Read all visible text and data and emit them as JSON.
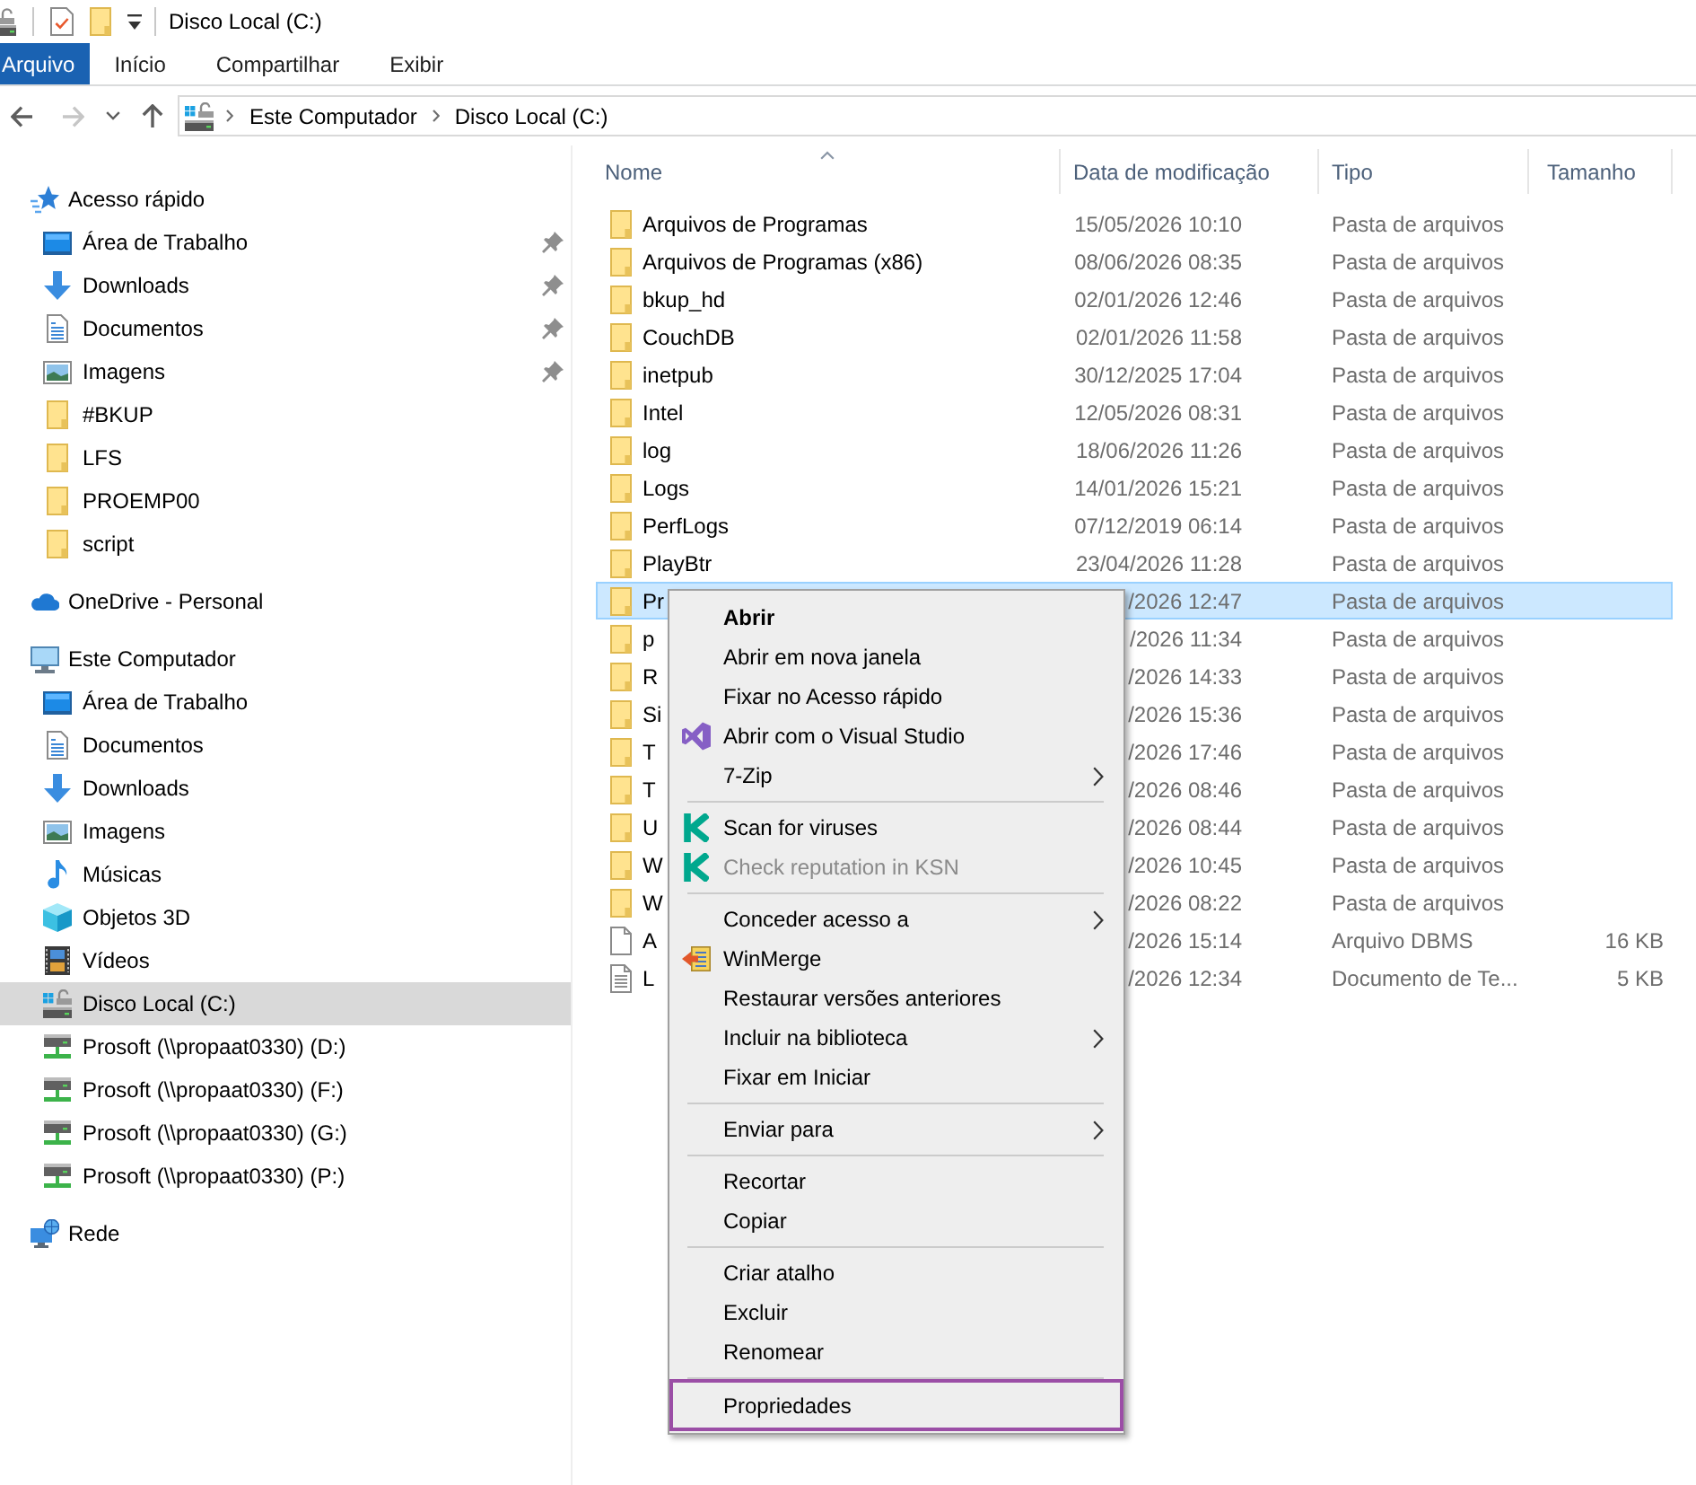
{
  "title_bar": {
    "title": "Disco Local (C:)"
  },
  "ribbon_tabs": [
    {
      "label": "Arquivo",
      "kind": "backstage"
    },
    {
      "label": "Início",
      "kind": "tab"
    },
    {
      "label": "Compartilhar",
      "kind": "tab"
    },
    {
      "label": "Exibir",
      "kind": "tab"
    }
  ],
  "navigation": [
    {
      "kind": "back",
      "disabled": false
    },
    {
      "kind": "forward",
      "disabled": true
    },
    {
      "kind": "recent",
      "disabled": false
    },
    {
      "kind": "up",
      "disabled": false
    }
  ],
  "address_bar": {
    "path": [
      "Este Computador",
      "Disco Local (C:)"
    ]
  },
  "sidebar": {
    "items": [
      {
        "label": "Acesso rápido",
        "kind": "star",
        "selected": false,
        "children": [
          {
            "label": "Área de Trabalho",
            "kind": "desktop",
            "pinned": true,
            "selected": false
          },
          {
            "label": "Downloads",
            "kind": "downloads",
            "pinned": true,
            "selected": false
          },
          {
            "label": "Documentos",
            "kind": "documents",
            "pinned": true,
            "selected": false
          },
          {
            "label": "Imagens",
            "kind": "pictures",
            "pinned": true,
            "selected": false
          },
          {
            "label": "#BKUP",
            "kind": "folder",
            "pinned": false,
            "selected": false
          },
          {
            "label": "LFS",
            "kind": "folder",
            "pinned": false,
            "selected": false
          },
          {
            "label": "PROEMP00",
            "kind": "folder",
            "pinned": false,
            "selected": false
          },
          {
            "label": "script",
            "kind": "folder",
            "pinned": false,
            "selected": false
          }
        ]
      },
      {
        "label": "OneDrive - Personal",
        "kind": "cloud",
        "selected": false
      },
      {
        "label": "Este Computador",
        "kind": "computer",
        "selected": false,
        "children": [
          {
            "label": "Área de Trabalho",
            "kind": "desktop",
            "selected": false
          },
          {
            "label": "Documentos",
            "kind": "documents",
            "selected": false
          },
          {
            "label": "Downloads",
            "kind": "downloads",
            "selected": false
          },
          {
            "label": "Imagens",
            "kind": "pictures",
            "selected": false
          },
          {
            "label": "Músicas",
            "kind": "music",
            "selected": false
          },
          {
            "label": "Objetos 3D",
            "kind": "cube",
            "selected": false
          },
          {
            "label": "Vídeos",
            "kind": "videos",
            "selected": false
          },
          {
            "label": "Disco Local (C:)",
            "kind": "drive",
            "selected": true
          },
          {
            "label": "Prosoft (\\\\propaat0330) (D:)",
            "kind": "netdrive",
            "selected": false
          },
          {
            "label": "Prosoft (\\\\propaat0330) (F:)",
            "kind": "netdrive",
            "selected": false
          },
          {
            "label": "Prosoft (\\\\propaat0330) (G:)",
            "kind": "netdrive",
            "selected": false
          },
          {
            "label": "Prosoft (\\\\propaat0330) (P:)",
            "kind": "netdrive",
            "selected": false
          }
        ]
      },
      {
        "label": "Rede",
        "kind": "network",
        "selected": false
      }
    ]
  },
  "file_list": {
    "columns": [
      {
        "label": "Nome",
        "sorted": true
      },
      {
        "label": "Data de modificação",
        "sorted": false
      },
      {
        "label": "Tipo",
        "sorted": false
      },
      {
        "label": "Tamanho",
        "sorted": false
      }
    ],
    "rows": [
      {
        "name": "Arquivos de Programas",
        "modified": "15/05/2026 10:10",
        "type": "Pasta de arquivos",
        "kind": "folder",
        "selected": false
      },
      {
        "name": "Arquivos de Programas (x86)",
        "modified": "08/06/2026 08:35",
        "type": "Pasta de arquivos",
        "kind": "folder",
        "selected": false
      },
      {
        "name": "bkup_hd",
        "modified": "02/01/2026 12:46",
        "type": "Pasta de arquivos",
        "kind": "folder",
        "selected": false
      },
      {
        "name": "CouchDB",
        "modified": "02/01/2026 11:58",
        "type": "Pasta de arquivos",
        "kind": "folder",
        "selected": false
      },
      {
        "name": "inetpub",
        "modified": "30/12/2025 17:04",
        "type": "Pasta de arquivos",
        "kind": "folder",
        "selected": false
      },
      {
        "name": "Intel",
        "modified": "12/05/2026 08:31",
        "type": "Pasta de arquivos",
        "kind": "folder",
        "selected": false
      },
      {
        "name": "log",
        "modified": "18/06/2026 11:26",
        "type": "Pasta de arquivos",
        "kind": "folder",
        "selected": false
      },
      {
        "name": "Logs",
        "modified": "14/01/2026 15:21",
        "type": "Pasta de arquivos",
        "kind": "folder",
        "selected": false
      },
      {
        "name": "PerfLogs",
        "modified": "07/12/2019 06:14",
        "type": "Pasta de arquivos",
        "kind": "folder",
        "selected": false
      },
      {
        "name": "PlayBtr",
        "modified": "23/04/2026 11:28",
        "type": "Pasta de arquivos",
        "kind": "folder",
        "selected": false
      },
      {
        "name": "Pr",
        "modified": "/2026 12:47",
        "type": "Pasta de arquivos",
        "kind": "folder",
        "selected": true
      },
      {
        "name": "p",
        "modified": "/2026 11:34",
        "type": "Pasta de arquivos",
        "kind": "folder",
        "selected": false
      },
      {
        "name": "R",
        "modified": "/2026 14:33",
        "type": "Pasta de arquivos",
        "kind": "folder",
        "selected": false
      },
      {
        "name": "Si",
        "modified": "/2026 15:36",
        "type": "Pasta de arquivos",
        "kind": "folder",
        "selected": false
      },
      {
        "name": "T",
        "modified": "/2026 17:46",
        "type": "Pasta de arquivos",
        "kind": "folder",
        "selected": false
      },
      {
        "name": "T",
        "modified": "/2026 08:46",
        "type": "Pasta de arquivos",
        "kind": "folder",
        "selected": false
      },
      {
        "name": "U",
        "modified": "/2026 08:44",
        "type": "Pasta de arquivos",
        "kind": "folder",
        "selected": false
      },
      {
        "name": "W",
        "modified": "/2026 10:45",
        "type": "Pasta de arquivos",
        "kind": "folder",
        "selected": false
      },
      {
        "name": "W",
        "modified": "/2026 08:22",
        "type": "Pasta de arquivos",
        "kind": "folder",
        "selected": false
      },
      {
        "name": "A",
        "modified": "/2026 15:14",
        "type": "Arquivo DBMS",
        "size": "16 KB",
        "kind": "file",
        "selected": false
      },
      {
        "name": "L",
        "modified": "/2026 12:34",
        "type": "Documento de Te...",
        "size": "5 KB",
        "kind": "document",
        "selected": false
      }
    ]
  },
  "context_menu": {
    "groups": [
      {
        "items": [
          {
            "label": "Abrir",
            "kind": "plain",
            "default": true,
            "disabled": false,
            "submenu": false,
            "highlighted": false
          },
          {
            "label": "Abrir em nova janela",
            "kind": "plain",
            "default": false,
            "disabled": false,
            "submenu": false,
            "highlighted": false
          },
          {
            "label": "Fixar no Acesso rápido",
            "kind": "plain",
            "default": false,
            "disabled": false,
            "submenu": false,
            "highlighted": false
          },
          {
            "label": "Abrir com o Visual Studio",
            "kind": "studio",
            "default": false,
            "disabled": false,
            "submenu": false,
            "highlighted": false
          },
          {
            "label": "7-Zip",
            "kind": "plain",
            "default": false,
            "disabled": false,
            "submenu": true,
            "highlighted": false
          }
        ]
      },
      {
        "items": [
          {
            "label": "Scan for viruses",
            "kind": "scanner",
            "default": false,
            "disabled": false,
            "submenu": false,
            "highlighted": false
          },
          {
            "label": "Check reputation in KSN",
            "kind": "scanner",
            "default": false,
            "disabled": true,
            "submenu": false,
            "highlighted": false
          }
        ]
      },
      {
        "items": [
          {
            "label": "Conceder acesso a",
            "kind": "plain",
            "default": false,
            "disabled": false,
            "submenu": true,
            "highlighted": false
          },
          {
            "label": "WinMerge",
            "kind": "merge",
            "default": false,
            "disabled": false,
            "submenu": false,
            "highlighted": false
          },
          {
            "label": "Restaurar versões anteriores",
            "kind": "plain",
            "default": false,
            "disabled": false,
            "submenu": false,
            "highlighted": false
          },
          {
            "label": "Incluir na biblioteca",
            "kind": "plain",
            "default": false,
            "disabled": false,
            "submenu": true,
            "highlighted": false
          },
          {
            "label": "Fixar em Iniciar",
            "kind": "plain",
            "default": false,
            "disabled": false,
            "submenu": false,
            "highlighted": false
          }
        ]
      },
      {
        "items": [
          {
            "label": "Enviar para",
            "kind": "plain",
            "default": false,
            "disabled": false,
            "submenu": true,
            "highlighted": false
          }
        ]
      },
      {
        "items": [
          {
            "label": "Recortar",
            "kind": "plain",
            "default": false,
            "disabled": false,
            "submenu": false,
            "highlighted": false
          },
          {
            "label": "Copiar",
            "kind": "plain",
            "default": false,
            "disabled": false,
            "submenu": false,
            "highlighted": false
          }
        ]
      },
      {
        "items": [
          {
            "label": "Criar atalho",
            "kind": "plain",
            "default": false,
            "disabled": false,
            "submenu": false,
            "highlighted": false
          },
          {
            "label": "Excluir",
            "kind": "plain",
            "default": false,
            "disabled": false,
            "submenu": false,
            "highlighted": false
          },
          {
            "label": "Renomear",
            "kind": "plain",
            "default": false,
            "disabled": false,
            "submenu": false,
            "highlighted": false
          }
        ]
      },
      {
        "items": [
          {
            "label": "Propriedades",
            "kind": "plain",
            "default": false,
            "disabled": false,
            "submenu": false,
            "highlighted": true
          }
        ]
      }
    ]
  }
}
